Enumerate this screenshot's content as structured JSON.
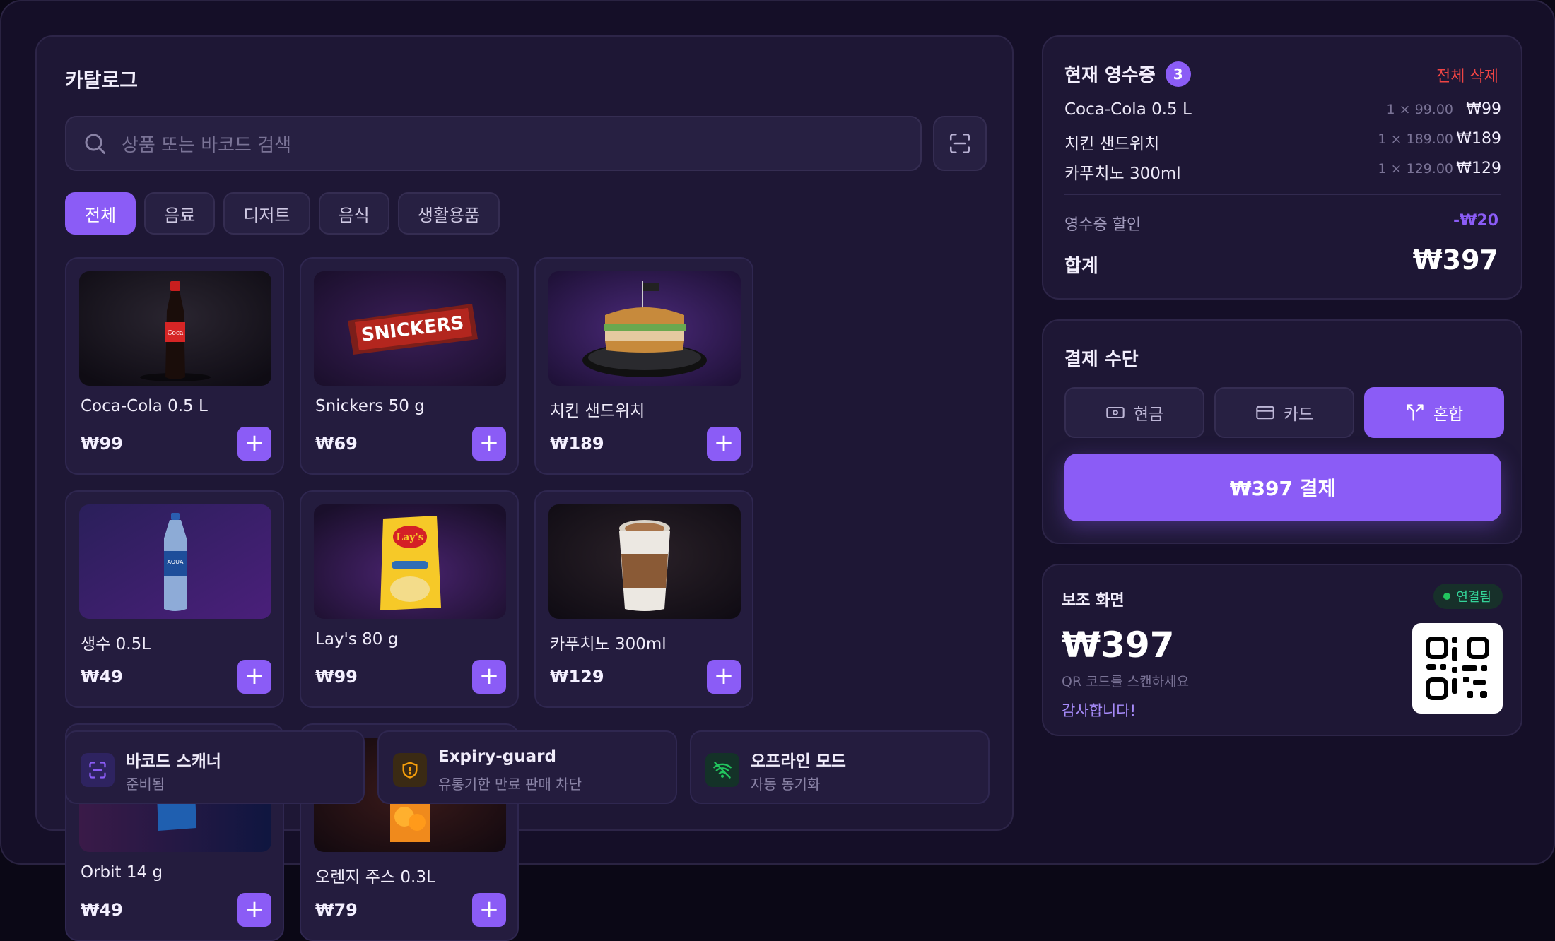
{
  "catalog": {
    "title": "카탈로그",
    "search_placeholder": "상품 또는 바코드 검색",
    "categories": [
      "전체",
      "음료",
      "디저트",
      "음식",
      "생활용품"
    ],
    "active_category": "전체",
    "products": [
      {
        "name": "Coca-Cola 0.5 L",
        "price": "₩99",
        "image": "cola-bottle"
      },
      {
        "name": "Snickers 50 g",
        "price": "₩69",
        "image": "snickers-bar"
      },
      {
        "name": "치킨 샌드위치",
        "price": "₩189",
        "image": "chicken-sandwich"
      },
      {
        "name": "생수 0.5L",
        "price": "₩49",
        "image": "water-bottle"
      },
      {
        "name": "Lay's 80 g",
        "price": "₩99",
        "image": "chips-bag"
      },
      {
        "name": "카푸치노 300ml",
        "price": "₩129",
        "image": "coffee-cup"
      },
      {
        "name": "Orbit 14 g",
        "price": "₩49",
        "image": "gum-pack"
      },
      {
        "name": "오렌지 주스 0.3L",
        "price": "₩79",
        "image": "juice-carton"
      }
    ],
    "add_label": "+",
    "features": [
      {
        "title": "바코드 스캐너",
        "subtitle": "준비됨",
        "icon": "barcode-scan-icon"
      },
      {
        "title": "Expiry-guard",
        "subtitle": "유통기한 만료 판매 차단",
        "icon": "shield-icon"
      },
      {
        "title": "오프라인 모드",
        "subtitle": "자동 동기화",
        "icon": "wifi-off-icon"
      }
    ]
  },
  "receipt": {
    "title": "현재 영수증",
    "count": "3",
    "clear_label": "전체 삭제",
    "items": [
      {
        "name": "Coca-Cola 0.5 L",
        "qty": "1 × 99.00",
        "amount": "₩99"
      },
      {
        "name": "치킨 샌드위치",
        "qty": "1 × 189.00",
        "amount": "₩189"
      },
      {
        "name": "카푸치노 300ml",
        "qty": "1 × 129.00",
        "amount": "₩129"
      }
    ],
    "discount_label": "영수증 할인",
    "discount_value": "-₩20",
    "total_label": "합계",
    "total_value": "₩397"
  },
  "payment": {
    "title": "결제 수단",
    "methods": [
      {
        "label": "현금",
        "icon": "cash-icon"
      },
      {
        "label": "카드",
        "icon": "card-icon"
      },
      {
        "label": "혼합",
        "icon": "split-icon"
      }
    ],
    "active_method": "혼합",
    "pay_button": "₩397 결제"
  },
  "secondary": {
    "title": "보조 화면",
    "status": "연결됨",
    "amount": "₩397",
    "hint": "QR 코드를 스캔하세요",
    "thanks": "감사합니다!"
  },
  "colors": {
    "accent": "#8b5cf6",
    "danger": "#ef4444",
    "success": "#22c55e",
    "background": "#150f28",
    "panel": "#1e1735"
  }
}
